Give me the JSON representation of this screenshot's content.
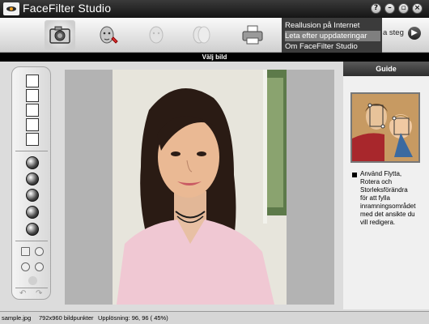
{
  "window": {
    "title": "FaceFilter Studio",
    "controls": [
      "help",
      "minimize",
      "restore",
      "close"
    ]
  },
  "toolbar": {
    "tools": [
      {
        "id": "camera",
        "icon": "camera-icon",
        "active": true
      },
      {
        "id": "face-tweak",
        "icon": "face-edit-icon",
        "active": false
      },
      {
        "id": "face-compare",
        "icon": "face-compare-icon",
        "active": false,
        "disabled": true
      },
      {
        "id": "face-merge",
        "icon": "face-merge-icon",
        "active": false,
        "disabled": true
      },
      {
        "id": "print",
        "icon": "printer-icon",
        "active": false
      }
    ],
    "menu": {
      "items": [
        "Reallusion på Internet",
        "Leta efter uppdateringar",
        "Om FaceFilter Studio"
      ],
      "highlighted_index": 1
    },
    "next_step_label": "a steg",
    "next_step_icon": "arrow-right-icon"
  },
  "header": {
    "title": "Välj bild"
  },
  "left_tools": {
    "group1": [
      "open-file-icon",
      "crop-icon",
      "copy-icon",
      "mirror-icon",
      "rotate-icon"
    ],
    "group2": [
      "brightness-icon",
      "contrast-icon",
      "sharpen-icon",
      "blur-icon",
      "color-icon"
    ],
    "group3": [
      "fit-icon",
      "no-icon",
      "zoom-in-icon",
      "zoom-out-icon",
      "hand-icon",
      "undo-icon",
      "redo-icon"
    ]
  },
  "guide": {
    "title": "Guide",
    "text": "Använd Flytta,\nRotera och\nStorleksförändra\nför att fylla\ninramningsområdet\nmed det ansikte du\nvill redigera."
  },
  "status": {
    "filename": "sample.jpg",
    "size": "792x960 bildpunkter",
    "resolution": "Upplösning: 96, 96 ( 45%)"
  },
  "colors": {
    "titlebar": "#1f1f1f",
    "menu_bg": "#3b3b3b",
    "menu_highlight": "#7f7f7f",
    "canvas_bg": "#b3b3b3",
    "header_bg": "#000000"
  }
}
